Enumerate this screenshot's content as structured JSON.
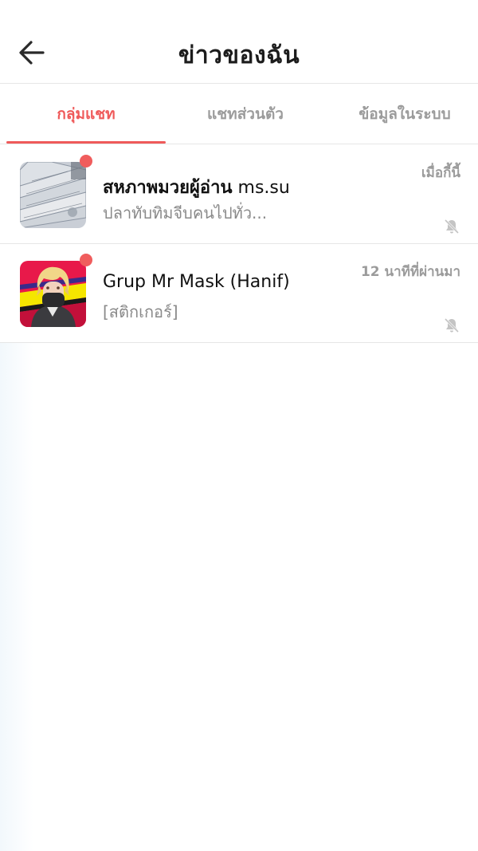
{
  "header": {
    "title": "ข่าวของฉัน",
    "back_icon": "arrow-left-icon"
  },
  "tabs": [
    {
      "label": "กลุ่มแชท",
      "active": true
    },
    {
      "label": "แชทส่วนตัว",
      "active": false
    },
    {
      "label": "ข้อมูลในระบบ",
      "active": false
    }
  ],
  "colors": {
    "accent": "#ef5a5a",
    "unread_dot": "#f05d5d",
    "muted_text": "#9b9b9b",
    "divider": "#e6e6e6"
  },
  "chats": [
    {
      "name_bold": "สหภาพมวยผู้อ่าน",
      "name_rest": " ms.su",
      "preview": "ปลาทับทิมจีบคนไปทั่ว...",
      "time": "เมื่อกี้นี้",
      "unread": true,
      "muted": true,
      "avatar": "banknotes-fan-image"
    },
    {
      "name_bold": "",
      "name_rest": "Grup Mr Mask (Hanif)",
      "preview": "[สติกเกอร์]",
      "time": "12 นาทีที่ผ่านมา",
      "unread": true,
      "muted": true,
      "avatar": "masked-anime-character-image"
    }
  ]
}
